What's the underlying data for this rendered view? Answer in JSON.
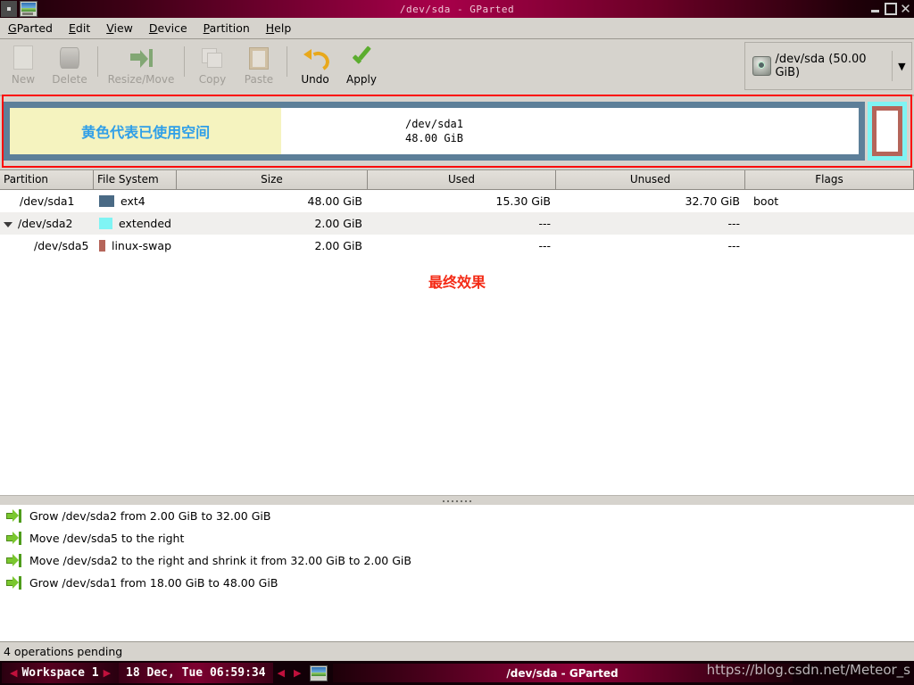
{
  "window": {
    "title": "/dev/sda - GParted",
    "minimize_label": "minimize",
    "maximize_label": "maximize",
    "close_label": "close"
  },
  "menubar": {
    "items": [
      {
        "label": "GParted",
        "mnemonic": "G"
      },
      {
        "label": "Edit",
        "mnemonic": "E"
      },
      {
        "label": "View",
        "mnemonic": "V"
      },
      {
        "label": "Device",
        "mnemonic": "D"
      },
      {
        "label": "Partition",
        "mnemonic": "P"
      },
      {
        "label": "Help",
        "mnemonic": "H"
      }
    ]
  },
  "toolbar": {
    "new_label": "New",
    "delete_label": "Delete",
    "resize_move_label": "Resize/Move",
    "copy_label": "Copy",
    "paste_label": "Paste",
    "undo_label": "Undo",
    "apply_label": "Apply"
  },
  "device_selector": {
    "icon": "harddisk-icon",
    "text": "/dev/sda  (50.00 GiB)",
    "caret": "▼"
  },
  "disk_graphic": {
    "partitions": [
      {
        "name": "/dev/sda1",
        "size_label": "48.00 GiB",
        "border_color": "#5d7f99",
        "used_fill_color": "#f5f3bf",
        "unused_fill_color": "#ffffff",
        "used_percent": 32
      },
      {
        "name": "/dev/sda2",
        "type": "extended",
        "border_color": "#7ff4f4",
        "child": {
          "name": "/dev/sda5",
          "border_color": "#b5655a",
          "fill_color": "#ffffff"
        }
      }
    ],
    "annotation_blue": "黄色代表已使用空间",
    "annotation_color": "#2f9fe8"
  },
  "annotations": {
    "final_result": "最终效果",
    "final_result_color": "#f42b16",
    "highlight_border_color": "#fb0a05"
  },
  "partition_table": {
    "columns": [
      "Partition",
      "File System",
      "Size",
      "Used",
      "Unused",
      "Flags"
    ],
    "rows": [
      {
        "partition": "/dev/sda1",
        "filesystem": "ext4",
        "fs_color": "#4a6a85",
        "size": "48.00 GiB",
        "used": "15.30 GiB",
        "unused": "32.70 GiB",
        "flags": "boot",
        "indent": 1,
        "expander": false
      },
      {
        "partition": "/dev/sda2",
        "filesystem": "extended",
        "fs_color": "#7ff4f4",
        "size": "2.00 GiB",
        "used": "---",
        "unused": "---",
        "flags": "",
        "indent": 0,
        "expander": true
      },
      {
        "partition": "/dev/sda5",
        "filesystem": "linux-swap",
        "fs_color": "#b5655a",
        "size": "2.00 GiB",
        "used": "---",
        "unused": "---",
        "flags": "",
        "indent": 2,
        "expander": false
      }
    ]
  },
  "operations": {
    "items": [
      "Grow /dev/sda2 from 2.00 GiB to 32.00 GiB",
      "Move /dev/sda5 to the right",
      "Move /dev/sda2 to the right and shrink it from 32.00 GiB to 2.00 GiB",
      "Grow /dev/sda1 from 18.00 GiB to 48.00 GiB"
    ]
  },
  "statusbar": {
    "text": "4 operations pending"
  },
  "taskbar": {
    "workspace_prev": "◀",
    "workspace_label": "Workspace 1",
    "workspace_next": "▶",
    "clock": "18 Dec, Tue 06:59:34",
    "task_prev": "◀",
    "task_next": "▶",
    "task_label": "/dev/sda - GParted"
  },
  "watermark": {
    "text": "https://blog.csdn.net/Meteor_s"
  }
}
